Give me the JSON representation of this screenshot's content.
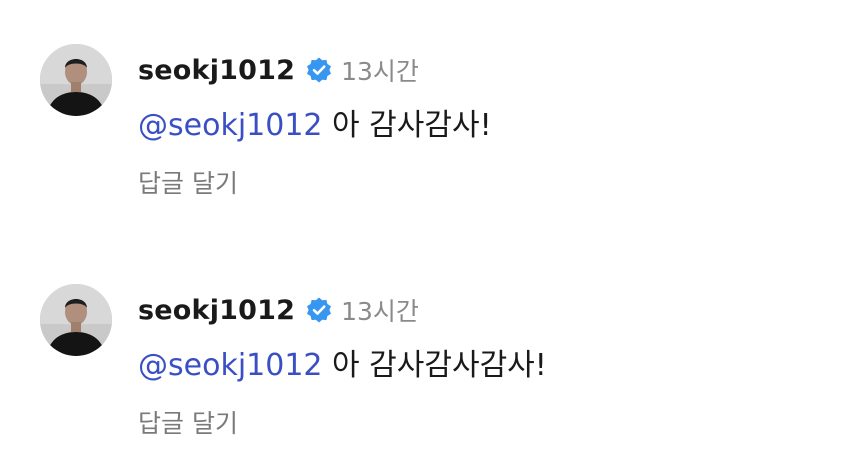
{
  "comments": [
    {
      "username": "seokj1012",
      "verified": true,
      "time": "13시간",
      "mention": "@seokj1012",
      "text": "아 감사감사!",
      "reply_label": "답글 달기"
    },
    {
      "username": "seokj1012",
      "verified": true,
      "time": "13시간",
      "mention": "@seokj1012",
      "text": "아 감사감사감사!",
      "reply_label": "답글 달기"
    }
  ],
  "colors": {
    "mention": "#3b4fc4",
    "verified_badge": "#3797f0",
    "username": "#1a1a1a",
    "secondary_text": "#8a8a8a"
  },
  "icons": {
    "verified": "verified-badge-icon",
    "avatar": "profile-photo"
  }
}
